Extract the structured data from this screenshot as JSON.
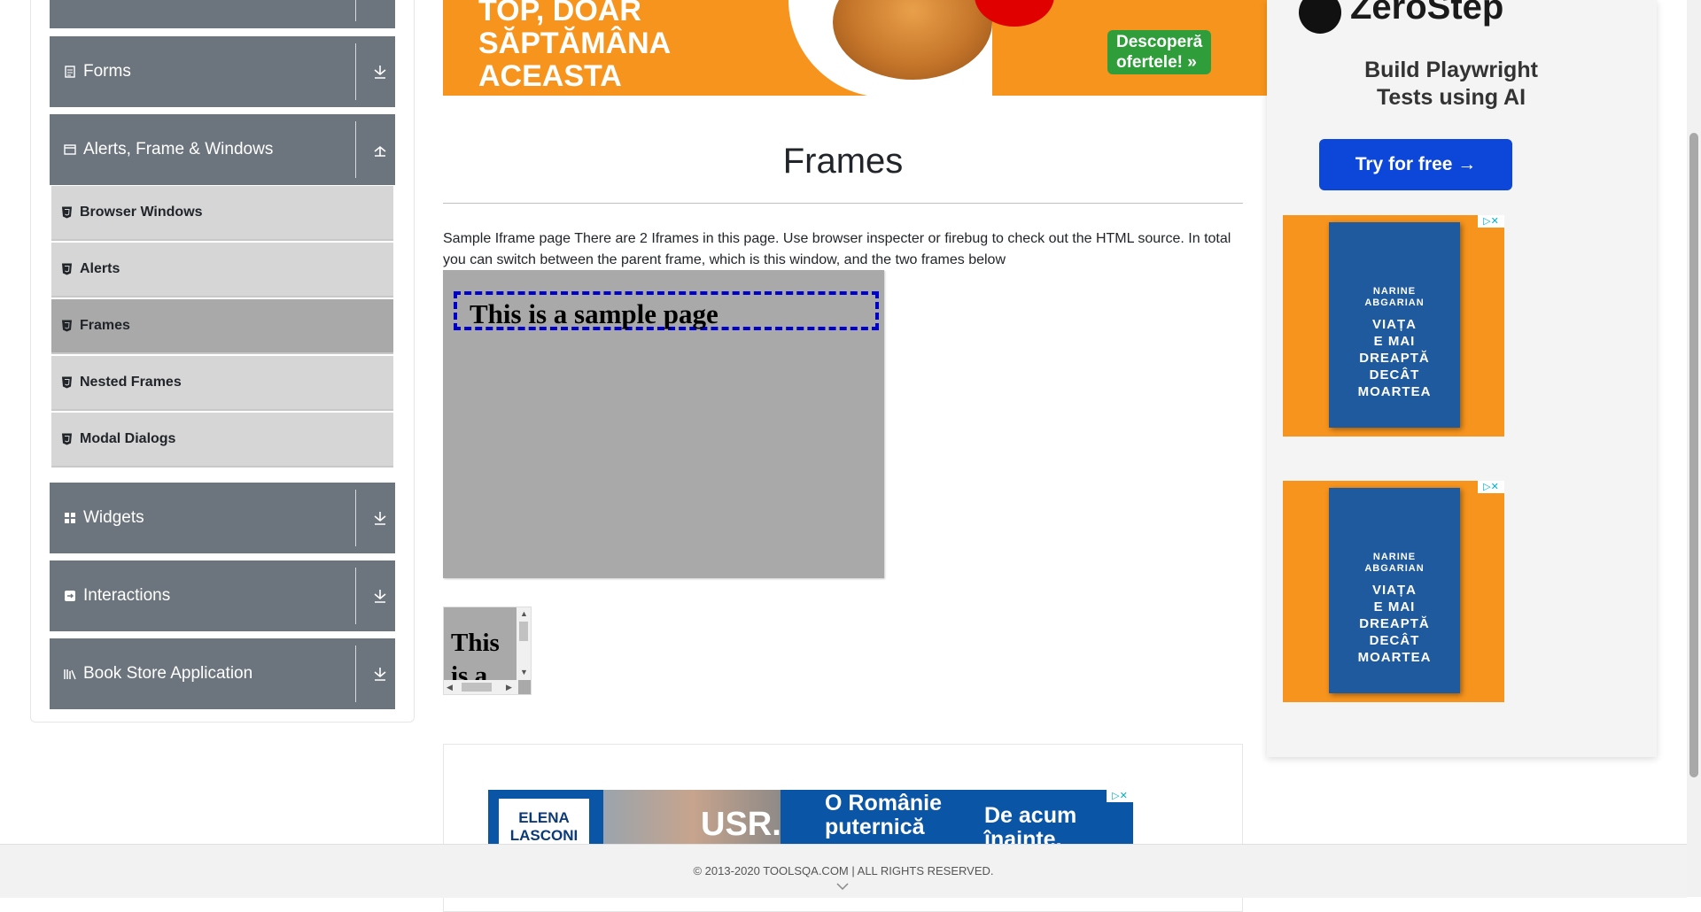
{
  "sidebar": {
    "groups": [
      {
        "label": "Forms",
        "icon": "form-icon",
        "state": "collapsed"
      },
      {
        "label": "Alerts, Frame & Windows",
        "icon": "window-icon",
        "state": "expanded"
      },
      {
        "label": "Widgets",
        "icon": "widgets-icon",
        "state": "collapsed"
      },
      {
        "label": "Interactions",
        "icon": "interactions-icon",
        "state": "collapsed"
      },
      {
        "label": "Book Store Application",
        "icon": "bookstore-icon",
        "state": "collapsed"
      }
    ],
    "items": [
      {
        "label": "Browser Windows"
      },
      {
        "label": "Alerts"
      },
      {
        "label": "Frames",
        "active": true
      },
      {
        "label": "Nested Frames"
      },
      {
        "label": "Modal Dialogs"
      }
    ]
  },
  "ads": {
    "top_banner": {
      "headline_1": "TOP, DOAR",
      "headline_2": "SĂPTĂMÂNA",
      "headline_3": "ACEASTA",
      "cta_1": "Descoperă",
      "cta_2": "ofertele! »"
    },
    "zerostep": {
      "brand": "ZeroStep",
      "tagline_1": "Build Playwright",
      "tagline_2": "Tests using AI",
      "button": "Try for free →"
    },
    "book": {
      "author_1": "NARINE",
      "author_2": "ABGARIAN",
      "title_1": "VIAȚA",
      "title_2": "E MAI",
      "title_3": "DREAPTĂ",
      "title_4": "DECÂT",
      "title_5": "MOARTEA",
      "adchoice": "▷✕"
    },
    "usr": {
      "name_1": "ELENA",
      "name_2": "LASCONI",
      "party": "USR.",
      "slogan_1": "O Românie",
      "slogan_2": "puternică",
      "slogan_3": "De acum",
      "slogan_4": "înainte."
    }
  },
  "main": {
    "title": "Frames",
    "description": "Sample Iframe page There are 2 Iframes in this page. Use browser inspecter or firebug to check out the HTML source. In total you can switch between the parent frame, which is this window, and the two frames below",
    "frame1_heading": "This is a sample page",
    "frame2_heading": "This is a sample page"
  },
  "footer": {
    "copyright": "© 2013-2020 TOOLSQA.COM | ALL RIGHTS RESERVED."
  },
  "colors": {
    "group_bg": "#6c757d",
    "item_bg": "#d6d6d6",
    "active_item_bg": "#a9a9a9",
    "frame_bg": "#a9a9a9",
    "frame_border": "#0000cc"
  }
}
